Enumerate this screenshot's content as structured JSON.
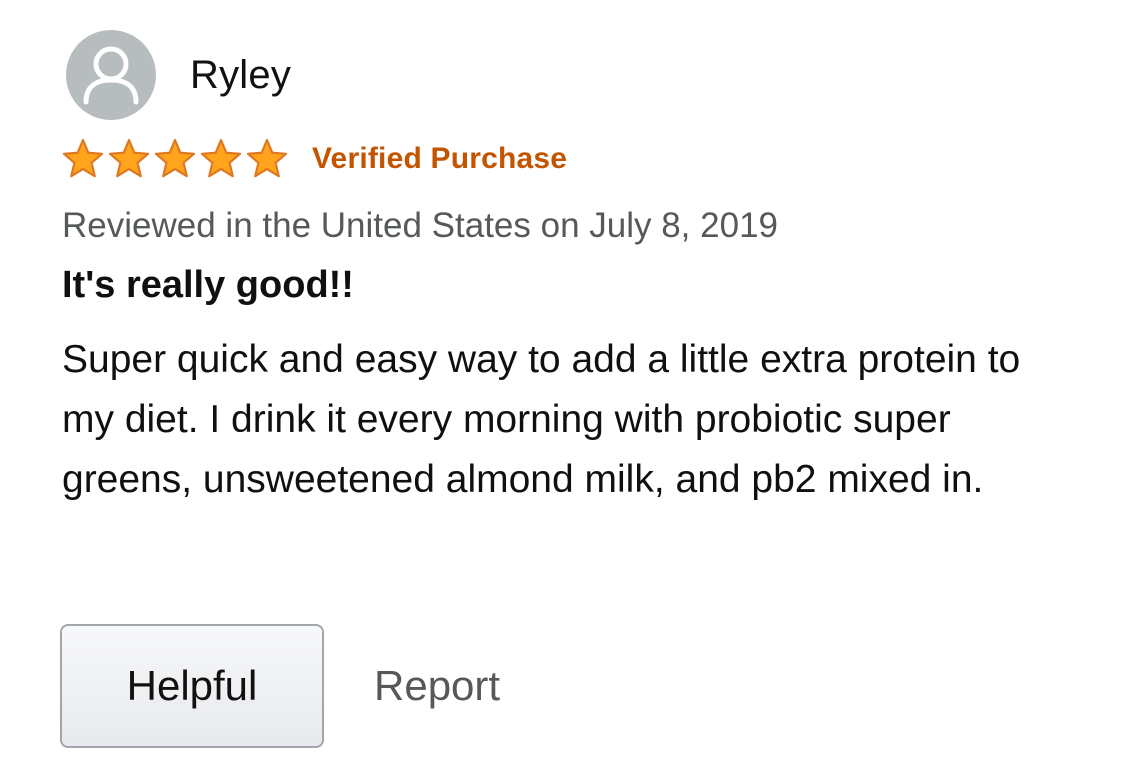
{
  "reviewer": {
    "name": "Ryley",
    "avatar_icon": "person-silhouette-icon"
  },
  "rating": {
    "stars": 5,
    "max_stars": 5,
    "star_color": "#ffa41c",
    "star_outline": "#de7921"
  },
  "badge": {
    "verified_label": "Verified Purchase",
    "color": "#c45500"
  },
  "review": {
    "date_line": "Reviewed in the United States on July 8, 2019",
    "title": "It's really good!!",
    "body": "Super quick and easy way to add a little extra protein to my diet. I drink it every morning with probiotic super greens, unsweetened almond milk, and pb2 mixed in."
  },
  "actions": {
    "helpful_label": "Helpful",
    "report_label": "Report"
  }
}
